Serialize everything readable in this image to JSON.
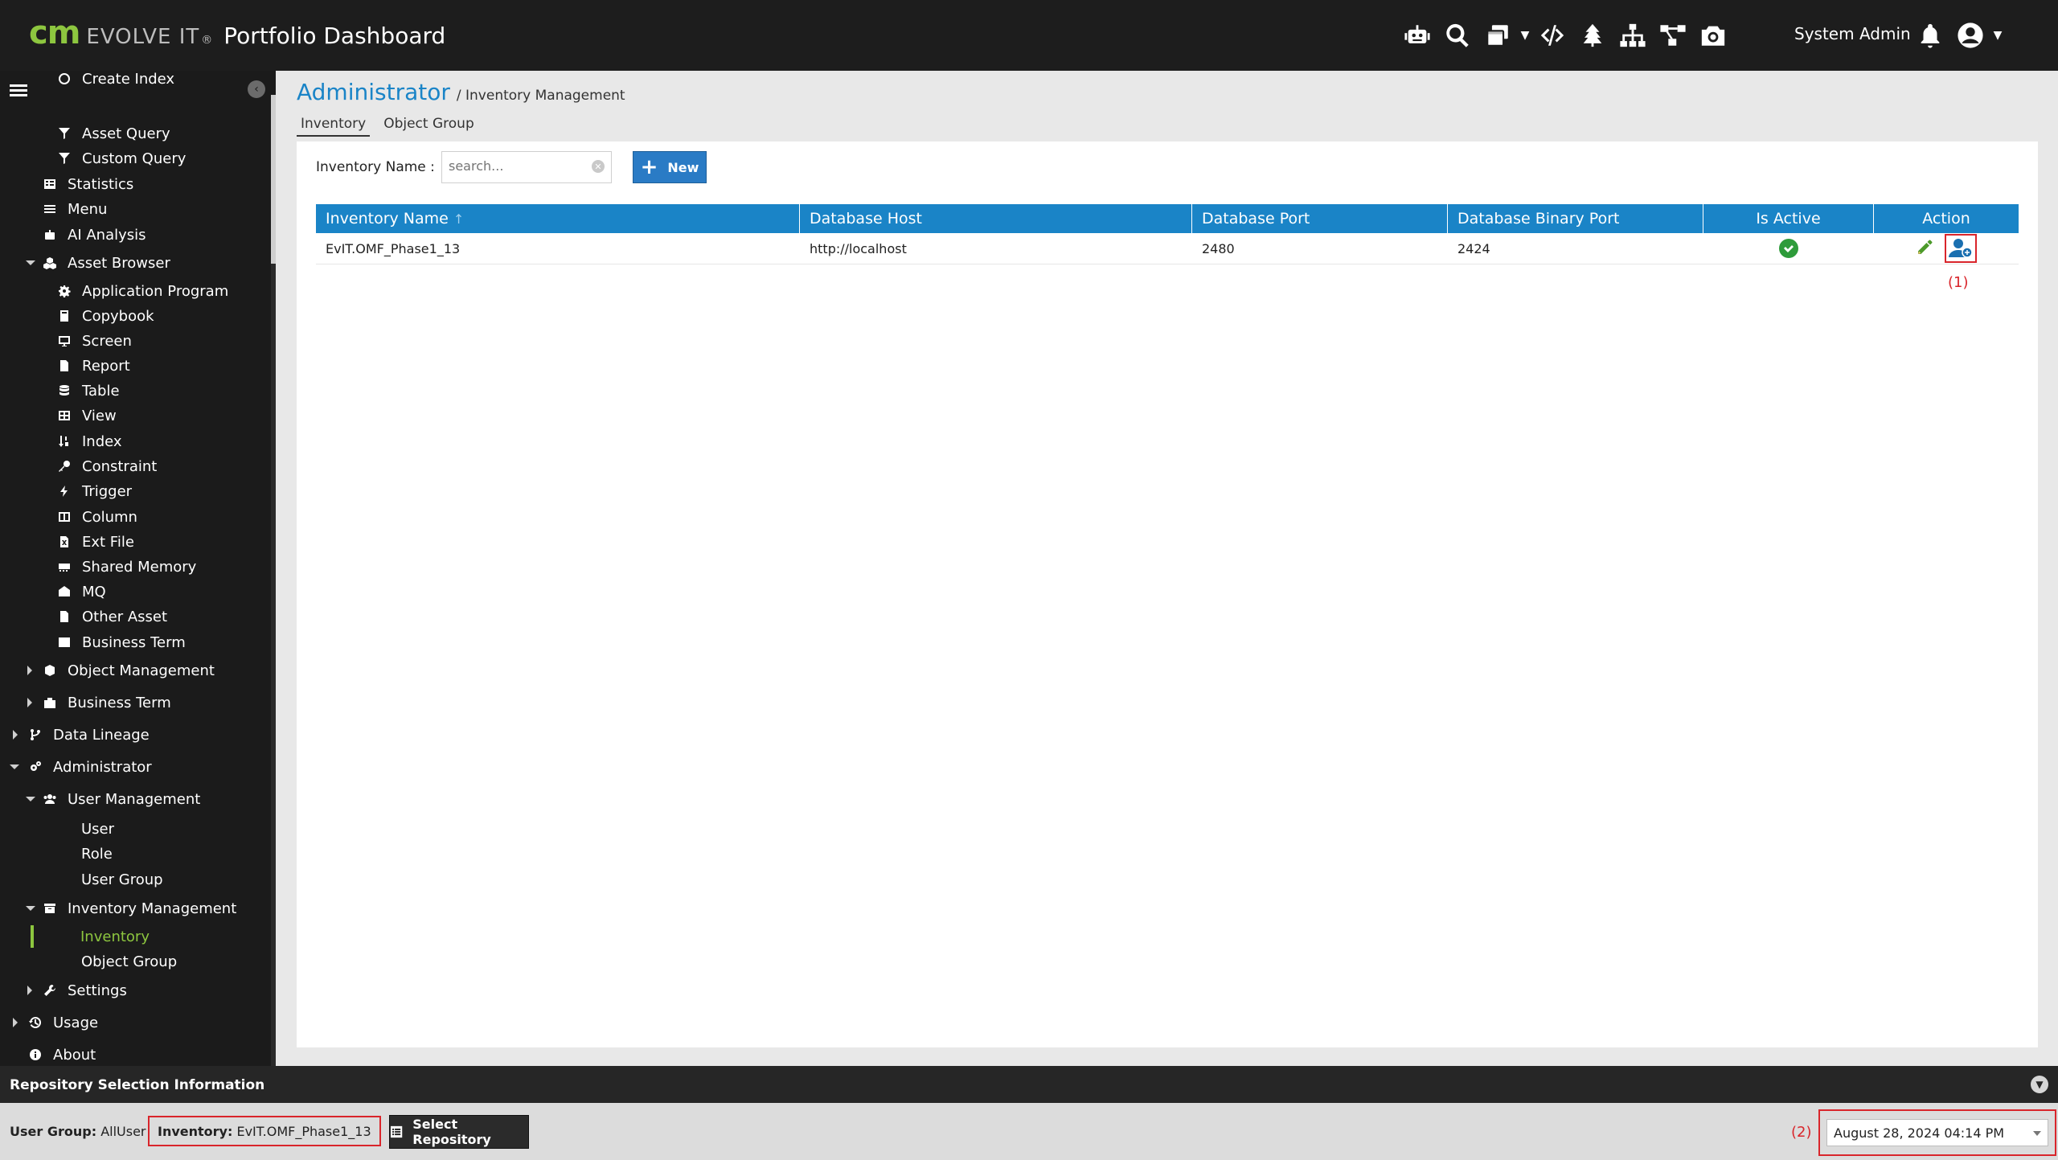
{
  "header": {
    "logo_cm": "cm",
    "logo_evolve": "EVOLVE IT",
    "logo_reg": "®",
    "app_title": "Portfolio Dashboard",
    "user_name": "System Admin",
    "icons": [
      "robot-icon",
      "search-icon",
      "windows-icon",
      "code-icon",
      "tree-icon",
      "sitemap-icon",
      "diagram-icon",
      "camera-icon",
      "bell-icon",
      "user-circle-icon"
    ]
  },
  "sidebar": {
    "items": [
      {
        "label": "Create Index"
      },
      {
        "label": "Asset Query"
      },
      {
        "label": "Custom Query"
      },
      {
        "label": "Statistics"
      },
      {
        "label": "Menu"
      },
      {
        "label": "AI Analysis"
      },
      {
        "label": "Asset Browser"
      },
      {
        "label": "Application Program"
      },
      {
        "label": "Copybook"
      },
      {
        "label": "Screen"
      },
      {
        "label": "Report"
      },
      {
        "label": "Table"
      },
      {
        "label": "View"
      },
      {
        "label": "Index"
      },
      {
        "label": "Constraint"
      },
      {
        "label": "Trigger"
      },
      {
        "label": "Column"
      },
      {
        "label": "Ext File"
      },
      {
        "label": "Shared Memory"
      },
      {
        "label": "MQ"
      },
      {
        "label": "Other Asset"
      },
      {
        "label": "Business Term"
      },
      {
        "label": "Object Management"
      },
      {
        "label": "Business Term"
      },
      {
        "label": "Data Lineage"
      },
      {
        "label": "Administrator"
      },
      {
        "label": "User Management"
      },
      {
        "label": "User"
      },
      {
        "label": "Role"
      },
      {
        "label": "User Group"
      },
      {
        "label": "Inventory Management"
      },
      {
        "label": "Inventory"
      },
      {
        "label": "Object Group"
      },
      {
        "label": "Settings"
      },
      {
        "label": "Usage"
      },
      {
        "label": "About"
      }
    ]
  },
  "breadcrumb": {
    "main": "Administrator",
    "sub": "/ Inventory Management"
  },
  "tabs": [
    {
      "label": "Inventory"
    },
    {
      "label": "Object Group"
    }
  ],
  "filter": {
    "label": "Inventory Name :",
    "placeholder": "search...",
    "new_label": "New"
  },
  "table": {
    "columns": [
      "Inventory Name",
      "Database Host",
      "Database Port",
      "Database Binary Port",
      "Is Active",
      "Action"
    ],
    "sort_indicator": "↑",
    "rows": [
      {
        "name": "EvIT.OMF_Phase1_13",
        "host": "http://localhost",
        "port": "2480",
        "binary_port": "2424",
        "active": true
      }
    ]
  },
  "annotations": {
    "a1": "(1)",
    "a2": "(2)"
  },
  "repo_bar": {
    "title": "Repository Selection Information"
  },
  "status": {
    "user_group_label": "User Group:",
    "user_group_value": "AllUser",
    "inventory_label": "Inventory:",
    "inventory_value": "EvIT.OMF_Phase1_13",
    "select_repo_label": "Select Repository",
    "datetime": "August 28, 2024 04:14 PM"
  },
  "colors": {
    "accent": "#1a84c7",
    "brand_green": "#8dc63f",
    "highlight_red": "#d9252b",
    "active_green": "#2e9b3a"
  }
}
